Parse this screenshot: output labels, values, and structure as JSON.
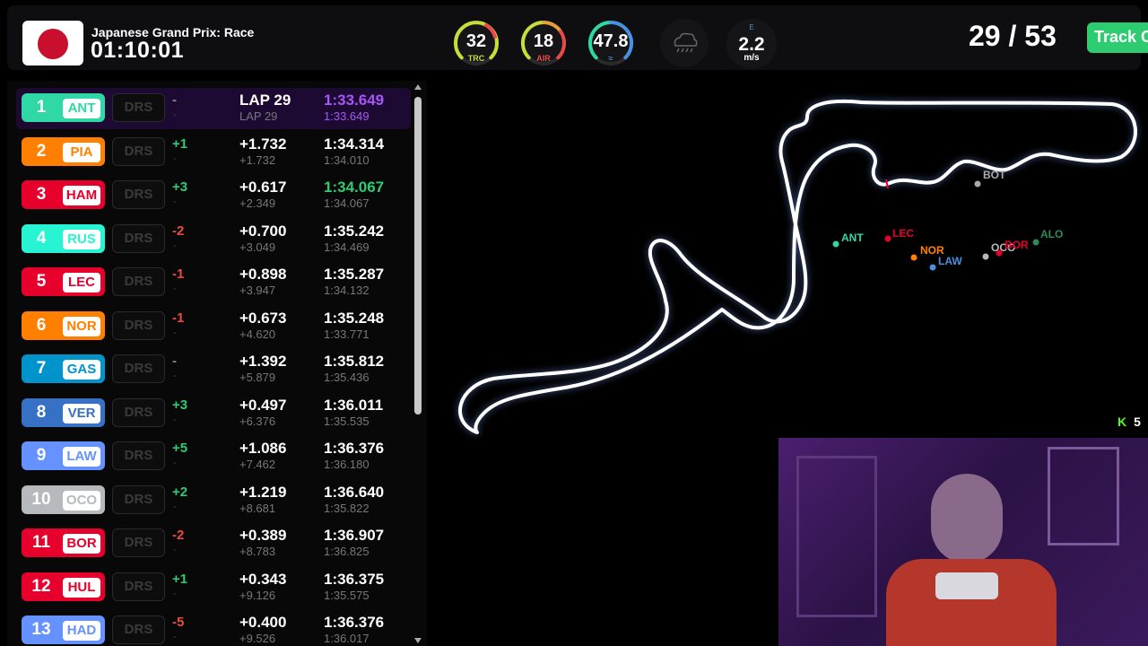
{
  "race": {
    "name": "Japanese Grand Prix: Race",
    "time": "01:10:01"
  },
  "weather": {
    "track_temp": {
      "value": "32",
      "label": "TRC",
      "color": "#d7e84a"
    },
    "air_temp": {
      "value": "18",
      "label": "AIR",
      "color": "#e84a4a"
    },
    "humidity": {
      "value": "47.8",
      "label": "",
      "color": "#4a90e2"
    },
    "rain_icon": "rain-cloud-icon",
    "wind": {
      "direction": "E",
      "value": "2.2",
      "unit": "m/s"
    }
  },
  "laps": {
    "display": "29 / 53"
  },
  "track_button": {
    "label": "Track C"
  },
  "leaderboard": [
    {
      "pos": "1",
      "code": "ANT",
      "color": "#2fd8a5",
      "drs": "DRS",
      "change": "-",
      "change_sub": "-",
      "gap": "LAP 29",
      "gap_sub": "LAP 29",
      "best": "1:33.649",
      "best_sub": "1:33.649",
      "best_color": "#a855f7",
      "change_color": "#888"
    },
    {
      "pos": "2",
      "code": "PIA",
      "color": "#ff8000",
      "drs": "DRS",
      "change": "+1",
      "change_sub": "-",
      "gap": "+1.732",
      "gap_sub": "+1.732",
      "best": "1:34.314",
      "best_sub": "1:34.010",
      "best_color": "#ffffff",
      "change_color": "#2ecc71"
    },
    {
      "pos": "3",
      "code": "HAM",
      "color": "#e8002d",
      "drs": "DRS",
      "change": "+3",
      "change_sub": "-",
      "gap": "+0.617",
      "gap_sub": "+2.349",
      "best": "1:34.067",
      "best_sub": "1:34.067",
      "best_color": "#2ecc71",
      "change_color": "#2ecc71"
    },
    {
      "pos": "4",
      "code": "RUS",
      "color": "#27f4d2",
      "drs": "DRS",
      "change": "-2",
      "change_sub": "-",
      "gap": "+0.700",
      "gap_sub": "+3.049",
      "best": "1:35.242",
      "best_sub": "1:34.469",
      "best_color": "#ffffff",
      "change_color": "#e74c3c"
    },
    {
      "pos": "5",
      "code": "LEC",
      "color": "#e8002d",
      "drs": "DRS",
      "change": "-1",
      "change_sub": "-",
      "gap": "+0.898",
      "gap_sub": "+3.947",
      "best": "1:35.287",
      "best_sub": "1:34.132",
      "best_color": "#ffffff",
      "change_color": "#e74c3c"
    },
    {
      "pos": "6",
      "code": "NOR",
      "color": "#ff8000",
      "drs": "DRS",
      "change": "-1",
      "change_sub": "-",
      "gap": "+0.673",
      "gap_sub": "+4.620",
      "best": "1:35.248",
      "best_sub": "1:33.771",
      "best_color": "#ffffff",
      "change_color": "#e74c3c"
    },
    {
      "pos": "7",
      "code": "GAS",
      "color": "#0093cc",
      "drs": "DRS",
      "change": "-",
      "change_sub": "-",
      "gap": "+1.392",
      "gap_sub": "+5.879",
      "best": "1:35.812",
      "best_sub": "1:35.436",
      "best_color": "#ffffff",
      "change_color": "#888"
    },
    {
      "pos": "8",
      "code": "VER",
      "color": "#3671c6",
      "drs": "DRS",
      "change": "+3",
      "change_sub": "-",
      "gap": "+0.497",
      "gap_sub": "+6.376",
      "best": "1:36.011",
      "best_sub": "1:35.535",
      "best_color": "#ffffff",
      "change_color": "#2ecc71"
    },
    {
      "pos": "9",
      "code": "LAW",
      "color": "#6692ff",
      "drs": "DRS",
      "change": "+5",
      "change_sub": "-",
      "gap": "+1.086",
      "gap_sub": "+7.462",
      "best": "1:36.376",
      "best_sub": "1:36.180",
      "best_color": "#ffffff",
      "change_color": "#2ecc71"
    },
    {
      "pos": "10",
      "code": "OCO",
      "color": "#b6babd",
      "drs": "DRS",
      "change": "+2",
      "change_sub": "-",
      "gap": "+1.219",
      "gap_sub": "+8.681",
      "best": "1:36.640",
      "best_sub": "1:35.822",
      "best_color": "#ffffff",
      "change_color": "#2ecc71"
    },
    {
      "pos": "11",
      "code": "BOR",
      "color": "#e8002d",
      "drs": "DRS",
      "change": "-2",
      "change_sub": "-",
      "gap": "+0.389",
      "gap_sub": "+8.783",
      "best": "1:36.907",
      "best_sub": "1:36.825",
      "best_color": "#ffffff",
      "change_color": "#e74c3c"
    },
    {
      "pos": "12",
      "code": "HUL",
      "color": "#e8002d",
      "drs": "DRS",
      "change": "+1",
      "change_sub": "-",
      "gap": "+0.343",
      "gap_sub": "+9.126",
      "best": "1:36.375",
      "best_sub": "1:35.575",
      "best_color": "#ffffff",
      "change_color": "#2ecc71"
    },
    {
      "pos": "13",
      "code": "HAD",
      "color": "#6692ff",
      "drs": "DRS",
      "change": "-5",
      "change_sub": "-",
      "gap": "+0.400",
      "gap_sub": "+9.526",
      "best": "1:36.376",
      "best_sub": "1:36.017",
      "best_color": "#ffffff",
      "change_color": "#e74c3c"
    }
  ],
  "map": {
    "drivers": [
      {
        "code": "BOT",
        "color": "#aaaaaa"
      },
      {
        "code": "ANT",
        "color": "#2fd8a5"
      },
      {
        "code": "LEC",
        "color": "#e8002d"
      },
      {
        "code": "NOR",
        "color": "#ff8000"
      },
      {
        "code": "LAW",
        "color": "#4a90e2"
      },
      {
        "code": "OCO",
        "color": "#b6babd"
      },
      {
        "code": "BOR",
        "color": "#e8002d"
      },
      {
        "code": "ALO",
        "color": "#2e8b57"
      }
    ]
  },
  "stream": {
    "kick_icon": "kick-logo-icon",
    "viewer_count": "5"
  }
}
